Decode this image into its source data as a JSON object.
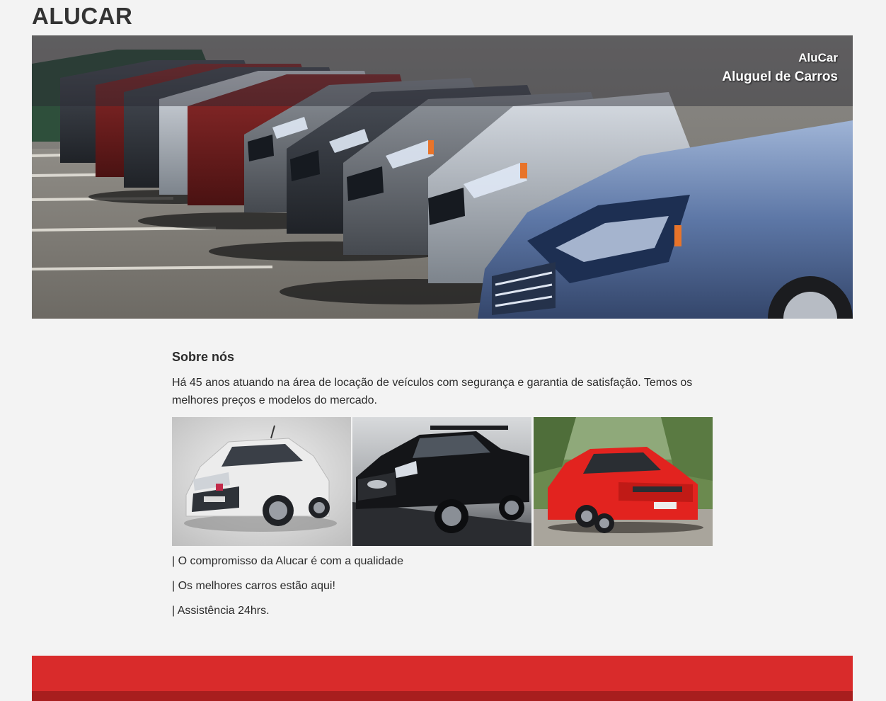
{
  "header": {
    "brand": "ALUCAR"
  },
  "hero": {
    "caption_line1": "AluCar",
    "caption_line2": "Aluguel de Carros"
  },
  "about": {
    "title": "Sobre nós",
    "text": "Há 45 anos atuando na área de locação de veículos com segurança e garantia de satisfação. Temos os melhores preços e modelos do mercado."
  },
  "gallery": {
    "photos": [
      {
        "icon": "white-hatchback-photo"
      },
      {
        "icon": "black-pickup-photo"
      },
      {
        "icon": "red-hatchback-photo"
      }
    ]
  },
  "highlights": [
    "| O compromisso da Alucar é com a qualidade",
    "| Os melhores carros estão aqui!",
    "| Assistência 24hrs."
  ],
  "colors": {
    "background": "#f3f3f3",
    "text": "#2b2b2b",
    "footer_red": "#d92b2b",
    "footer_dark_red": "#a81e1e"
  }
}
